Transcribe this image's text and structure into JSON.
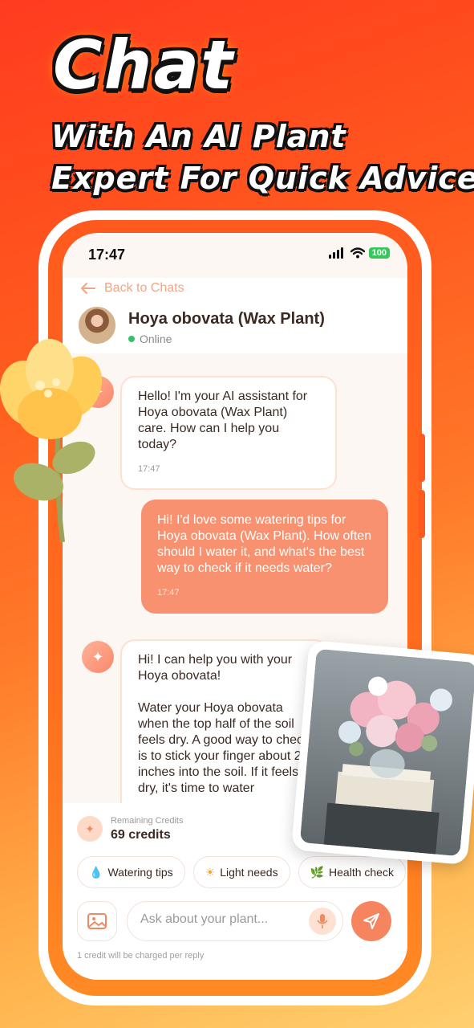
{
  "headline": {
    "title": "Chat",
    "subtitle_line1": "With An AI Plant",
    "subtitle_line2": "Expert For Quick Advice"
  },
  "status_bar": {
    "time": "17:47",
    "battery": "100"
  },
  "header": {
    "back_label": "Back to Chats",
    "plant_name": "Hoya obovata (Wax Plant)",
    "status": "Online"
  },
  "messages": [
    {
      "sender": "bot",
      "text": "Hello! I'm your AI assistant for Hoya obovata (Wax Plant) care. How can I help you today?",
      "time": "17:47"
    },
    {
      "sender": "user",
      "text": "Hi! I'd love some watering tips for Hoya obovata (Wax Plant). How often should I water it, and what's the best way to check if it needs water?",
      "time": "17:47"
    },
    {
      "sender": "bot",
      "text": "Hi! I can help you with your Hoya obovata!\n\nWater your Hoya obovata when the top half of the soil feels dry. A good way to check is to stick your finger about 2 inches into the soil. If it feels dry, it's time to water"
    }
  ],
  "credits": {
    "label": "Remaining Credits",
    "value": "69 credits"
  },
  "quick_replies": [
    {
      "icon": "water-drop-icon",
      "label": "Watering tips"
    },
    {
      "icon": "sun-icon",
      "label": "Light needs"
    },
    {
      "icon": "leaf-icon",
      "label": "Health check"
    }
  ],
  "composer": {
    "placeholder": "Ask about your plant...",
    "note": "1 credit will be charged per reply"
  },
  "colors": {
    "accent": "#f8916f",
    "online": "#33c26b",
    "background": "#ff5a1e"
  }
}
